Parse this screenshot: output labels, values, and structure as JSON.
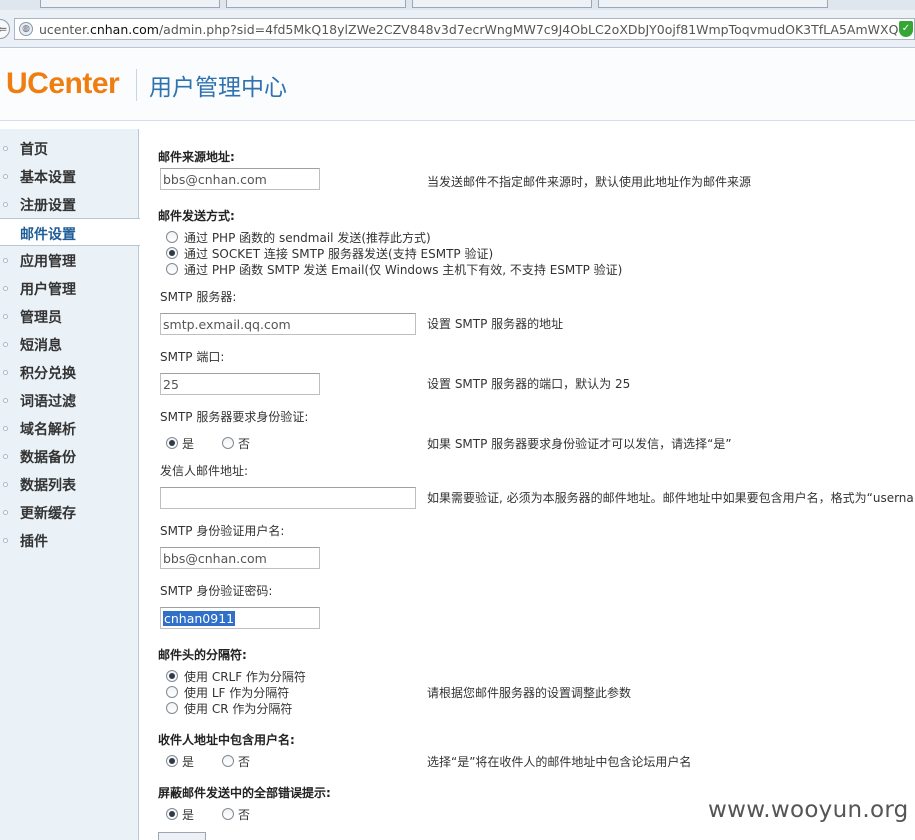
{
  "browser": {
    "url_prefix": "ucenter.",
    "url_domain": "cnhan.com",
    "url_path": "/admin.php?sid=4fd5MkQ18ylZWe2CZV848v3d7ecrWngMW7c9J4ObLC2oXDbJY0ojf81WmpToqvmudOK3TfLA5AmWXQ",
    "back_glyph": "⇐",
    "globe_icon": "globe-icon",
    "security_icon": "shield-check-icon",
    "shield_glyph": "✓"
  },
  "header": {
    "logo_text": "UCenter",
    "title": "用户管理中心"
  },
  "sidebar": {
    "items": [
      {
        "label": "首页"
      },
      {
        "label": "基本设置"
      },
      {
        "label": "注册设置"
      },
      {
        "label": "邮件设置",
        "active": true
      },
      {
        "label": "应用管理"
      },
      {
        "label": "用户管理"
      },
      {
        "label": "管理员"
      },
      {
        "label": "短消息"
      },
      {
        "label": "积分兑换"
      },
      {
        "label": "词语过滤"
      },
      {
        "label": "域名解析"
      },
      {
        "label": "数据备份"
      },
      {
        "label": "数据列表"
      },
      {
        "label": "更新缓存"
      },
      {
        "label": "插件"
      }
    ]
  },
  "form": {
    "mail_from": {
      "label": "邮件来源地址:",
      "value": "bbs@cnhan.com",
      "note": "当发送邮件不指定邮件来源时，默认使用此地址作为邮件来源"
    },
    "send_method": {
      "label": "邮件发送方式:",
      "options": [
        {
          "label": "通过 PHP 函数的 sendmail 发送(推荐此方式)",
          "checked": false
        },
        {
          "label": "通过 SOCKET 连接 SMTP 服务器发送(支持 ESMTP 验证)",
          "checked": true
        },
        {
          "label": "通过 PHP 函数 SMTP 发送 Email(仅 Windows 主机下有效, 不支持 ESMTP 验证)",
          "checked": false
        }
      ]
    },
    "smtp_server": {
      "label": "SMTP 服务器:",
      "value": "smtp.exmail.qq.com",
      "note": "设置 SMTP 服务器的地址"
    },
    "smtp_port": {
      "label": "SMTP 端口:",
      "value": "25",
      "note": "设置 SMTP 服务器的端口，默认为 25"
    },
    "smtp_auth": {
      "label": "SMTP 服务器要求身份验证:",
      "yes": "是",
      "no": "否",
      "value": "yes",
      "note": "如果 SMTP 服务器要求身份验证才可以发信，请选择“是”"
    },
    "sender_address": {
      "label": "发信人邮件地址:",
      "value": "",
      "note": "如果需要验证, 必须为本服务器的邮件地址。邮件地址中如果要包含用户名，格式为“userna"
    },
    "auth_username": {
      "label": "SMTP 身份验证用户名:",
      "value": "bbs@cnhan.com"
    },
    "auth_password": {
      "label": "SMTP 身份验证密码:",
      "value": "cnhan0911"
    },
    "header_delimiter": {
      "label": "邮件头的分隔符:",
      "options": [
        {
          "label": "使用 CRLF 作为分隔符",
          "checked": true
        },
        {
          "label": "使用 LF 作为分隔符",
          "checked": false
        },
        {
          "label": "使用 CR 作为分隔符",
          "checked": false
        }
      ],
      "note": "请根据您邮件服务器的设置调整此参数"
    },
    "include_username": {
      "label": "收件人地址中包含用户名:",
      "yes": "是",
      "no": "否",
      "value": "yes",
      "note": "选择“是”将在收件人的邮件地址中包含论坛用户名"
    },
    "silent_errors": {
      "label": "屏蔽邮件发送中的全部错误提示:",
      "yes": "是",
      "no": "否",
      "value": "yes"
    }
  },
  "watermark": "www.wooyun.org"
}
